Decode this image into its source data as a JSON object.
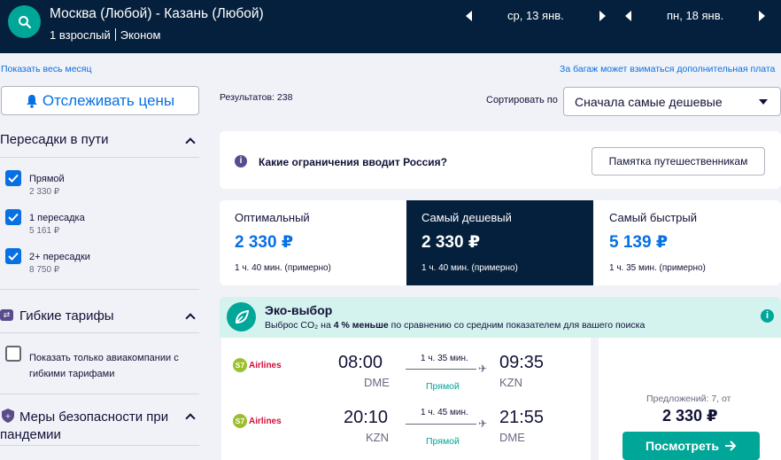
{
  "header": {
    "route": "Москва (Любой) - Казань (Любой)",
    "passengers": "1 взрослый",
    "cabin": "Эконом",
    "depart_date": "ср, 13 янв.",
    "return_date": "пн, 18 янв."
  },
  "links": {
    "whole_month": "Показать весь месяц",
    "baggage_note": "За багаж может взиматься дополнительная плата"
  },
  "sidebar": {
    "track_prices": "Отслеживать цены",
    "stops_title": "Пересадки в пути",
    "stops": [
      {
        "label": "Прямой",
        "price": "2 330 ₽",
        "checked": true
      },
      {
        "label": "1 пересадка",
        "price": "5 161 ₽",
        "checked": true
      },
      {
        "label": "2+ пересадки",
        "price": "8 750 ₽",
        "checked": true
      }
    ],
    "flex_title": "Гибкие тарифы",
    "flex_option": "Показать только авиакомпании с гибкими тарифами",
    "safety_title": "Меры безопасности при пандемии"
  },
  "results": {
    "count_label": "Результатов: 238",
    "sort_label": "Сортировать по",
    "sort_value": "Сначала самые дешевые"
  },
  "info_banner": {
    "question": "Какие ограничения вводит Россия?",
    "button": "Памятка путешественникам"
  },
  "tabs": [
    {
      "title": "Оптимальный",
      "price": "2 330 ₽",
      "duration": "1 ч. 40 мин. (примерно)",
      "active": false
    },
    {
      "title": "Самый дешевый",
      "price": "2 330 ₽",
      "duration": "1 ч. 40 мин. (примерно)",
      "active": true
    },
    {
      "title": "Самый быстрый",
      "price": "5 139 ₽",
      "duration": "1 ч. 35 мин. (примерно)",
      "active": false
    }
  ],
  "eco": {
    "title": "Эко-выбор",
    "desc_pre": "Выброс CO₂ на ",
    "desc_bold": "4 % меньше",
    "desc_post": " по сравнению со средним показателем для вашего поиска"
  },
  "flight": {
    "legs": [
      {
        "airline": "Airlines",
        "logo_mark": "S7",
        "dep_time": "08:00",
        "dep_airport": "DME",
        "duration": "1 ч. 35 мин.",
        "stops": "Прямой",
        "arr_time": "09:35",
        "arr_airport": "KZN"
      },
      {
        "airline": "Airlines",
        "logo_mark": "S7",
        "dep_time": "20:10",
        "dep_airport": "KZN",
        "duration": "1 ч. 45 мин.",
        "stops": "Прямой",
        "arr_time": "21:55",
        "arr_airport": "DME"
      }
    ],
    "offers": "Предложений: 7, от",
    "price": "2 330 ₽",
    "view_button": "Посмотреть"
  },
  "colors": {
    "header_bg": "#05203c",
    "accent": "#00a698",
    "link": "#0770e3",
    "eco_bg": "#d4f2ee"
  }
}
